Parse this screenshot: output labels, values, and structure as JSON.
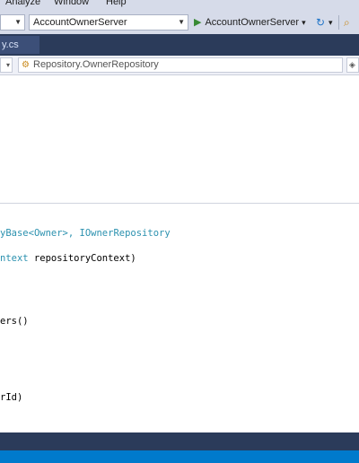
{
  "menu": {
    "items": [
      "Analyze",
      "Window",
      "Help"
    ]
  },
  "toolbar": {
    "config_value": "",
    "project_value": "AccountOwnerServer",
    "run_label": "AccountOwnerServer",
    "run_arrow": "▾",
    "refresh_icon": "refresh-icon",
    "search_icon": "find-icon"
  },
  "tab": {
    "label": "y.cs"
  },
  "navbar": {
    "left_value": "",
    "middle_value": "Repository.OwnerRepository"
  },
  "code": {
    "line1_type1": "yBase<",
    "line1_type2": "Owner",
    "line1_mid": ">, ",
    "line1_type3": "IOwnerRepository",
    "line2_type": "ntext",
    "line2_rest": " repositoryContext)",
    "line3": "ers()",
    "line4": "rId)"
  },
  "colors": {
    "chrome": "#d6dbe9",
    "tab_strip": "#2b3b5a",
    "status_bar": "#007acc",
    "type_color": "#2b91af"
  }
}
